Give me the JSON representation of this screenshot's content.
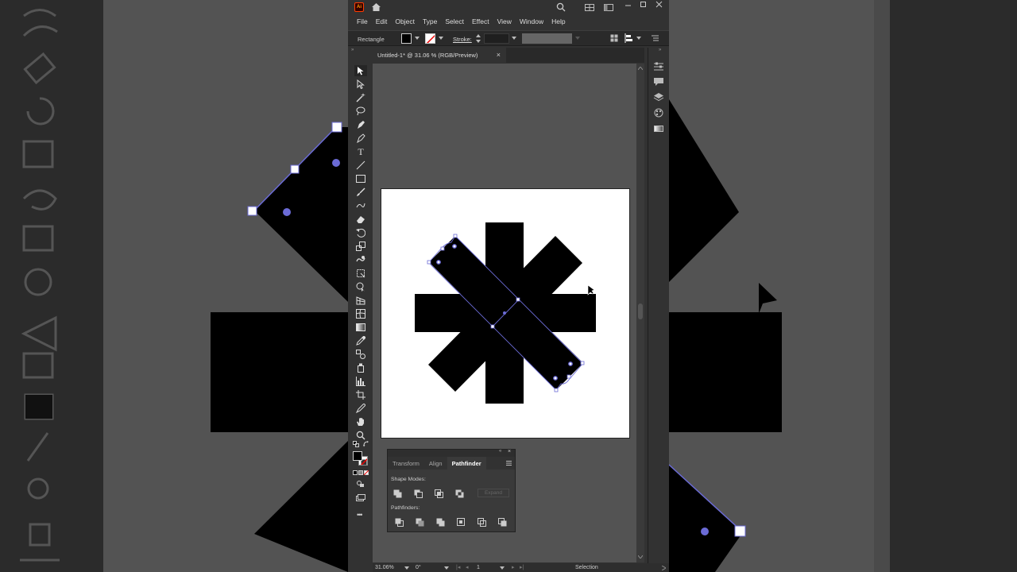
{
  "menu": [
    "File",
    "Edit",
    "Object",
    "Type",
    "Select",
    "Effect",
    "View",
    "Window",
    "Help"
  ],
  "control_bar": {
    "tool_name": "Rectangle",
    "stroke_label": "Stroke:"
  },
  "document_tab": {
    "title": "Untitled-1* @ 31.06 % (RGB/Preview)",
    "close_glyph": "×"
  },
  "pathfinder_panel": {
    "tabs": [
      "Transform",
      "Align",
      "Pathfinder"
    ],
    "active_tab": "Pathfinder",
    "shape_modes_label": "Shape Modes:",
    "pathfinders_label": "Pathfinders:",
    "expand_label": "Expand"
  },
  "status_bar": {
    "zoom": "31.06%",
    "rotation": "0°",
    "artboard_number": "1",
    "current_tool": "Selection"
  },
  "colors": {
    "app_bg": "#323232",
    "canvas_bg": "#535353",
    "artboard": "#ffffff",
    "shape_fill": "#000000",
    "selection": "#6b6bd6",
    "ai_logo": "#ff3d00"
  }
}
